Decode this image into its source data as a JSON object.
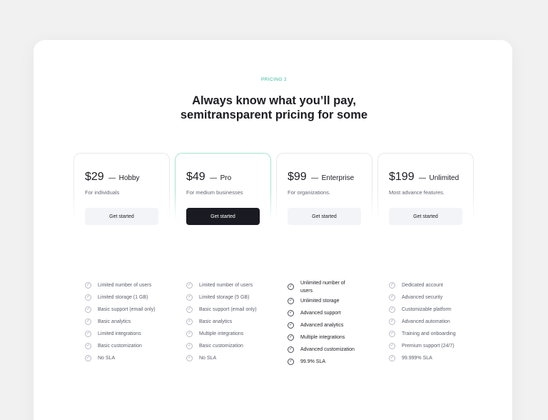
{
  "section": {
    "eyebrow": "PRICING 2",
    "headline_line1": "Always know what you’ll pay,",
    "headline_line2": "semitransparent pricing for some"
  },
  "plans": [
    {
      "price": "$29",
      "separator": "—",
      "name": "Hobby",
      "description": "For individuals",
      "cta": "Get started",
      "features": [
        "Limited number of users",
        "Limited storage (1 GB)",
        "Basic support (email only)",
        "Basic analytics",
        "Limited integrations",
        "Basic customization",
        "No SLA"
      ]
    },
    {
      "price": "$49",
      "separator": "—",
      "name": "Pro",
      "description": "For medium businesses",
      "cta": "Get started",
      "features": [
        "Limited number of users",
        "Limited storage (5 GB)",
        "Basic support (email only)",
        "Basic analytics",
        "Multiple integrations",
        "Basic customization",
        "No SLA"
      ]
    },
    {
      "price": "$99",
      "separator": "—",
      "name": "Enterprise",
      "description": "For organizations.",
      "cta": "Get started",
      "features": [
        "Unlimited number of users",
        "Unlimited storage",
        "Advanced support",
        "Advanced analytics",
        "Multiple integrations",
        "Advanced customization",
        "99.9% SLA"
      ]
    },
    {
      "price": "$199",
      "separator": "—",
      "name": "Unlimited",
      "description": "Most advance features.",
      "cta": "Get started",
      "features": [
        "Dedicated account",
        "Advanced security",
        "Customizable platform",
        "Advanced automation",
        "Training and onboarding",
        "Premium support (24/7)",
        "99.999% SLA"
      ]
    }
  ],
  "icons": {
    "feature": "check-circle-icon"
  },
  "colors": {
    "accent": "#2db89a",
    "featured_border": "#a6e3d3",
    "cta_dark": "#1a1a22",
    "cta_light": "#f2f4f7"
  }
}
